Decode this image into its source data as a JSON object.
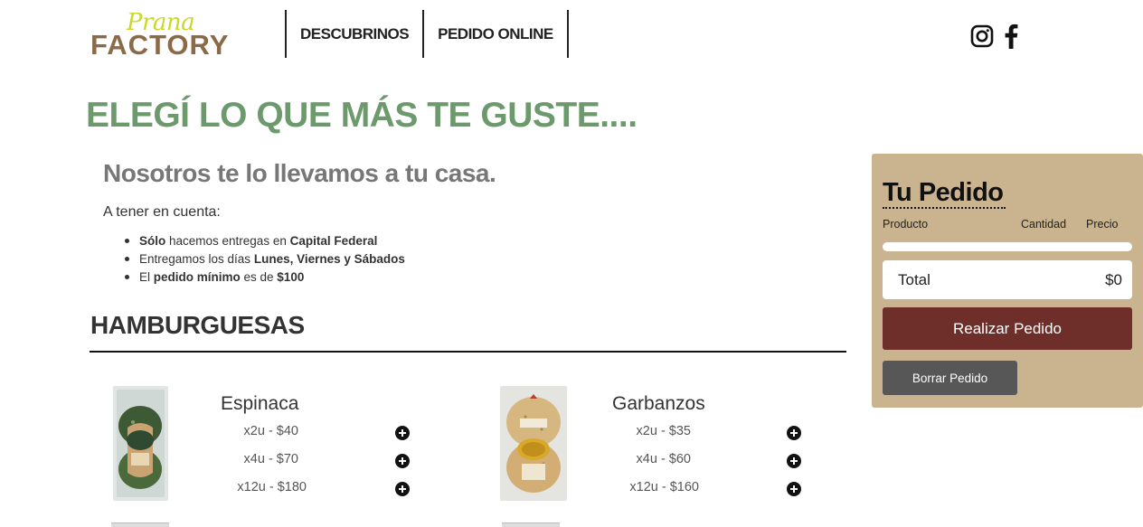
{
  "header": {
    "logo": {
      "script_text": "Prana",
      "main_text": "FACTORY"
    },
    "nav": [
      {
        "label": "DESCUBRINOS"
      },
      {
        "label": "PEDIDO ONLINE"
      }
    ],
    "social": [
      {
        "icon": "instagram-icon"
      },
      {
        "icon": "facebook-icon"
      }
    ]
  },
  "intro": {
    "title": "ELEGÍ LO QUE MÁS TE GUSTE....",
    "subtitle": "Nosotros te lo llevamos a tu casa.",
    "note_heading": "A tener en cuenta:",
    "notes": [
      {
        "a": "Sólo",
        "b": " hacemos entregas en ",
        "c": "Capital Federal",
        "d": ""
      },
      {
        "a": "",
        "b": "Entregamos los días ",
        "c": "Lunes, Viernes y Sábados",
        "d": ""
      },
      {
        "a": "",
        "b": "El ",
        "c": "pedido mínimo",
        "d": " es de ",
        "e": "$100"
      }
    ]
  },
  "section": {
    "title": "HAMBURGUESAS",
    "products": [
      {
        "name": "Espinaca",
        "options": [
          "x2u - $40",
          "x4u - $70",
          "x12u - $180"
        ]
      },
      {
        "name": "Garbanzos",
        "options": [
          "x2u - $35",
          "x4u - $60",
          "x12u - $160"
        ]
      }
    ]
  },
  "order": {
    "title": "Tu Pedido",
    "columns": {
      "product": "Producto",
      "quantity": "Cantidad",
      "price": "Precio"
    },
    "total_label": "Total",
    "total_value": "$0",
    "submit_label": "Realizar Pedido",
    "clear_label": "Borrar Pedido"
  },
  "colors": {
    "title_green": "#6d9a6d",
    "panel_bg": "#c9b48f",
    "order_button": "#6e2e2a",
    "clear_button": "#575757",
    "logo_brown": "#8b6a47",
    "logo_yellow": "#c9d92a"
  }
}
